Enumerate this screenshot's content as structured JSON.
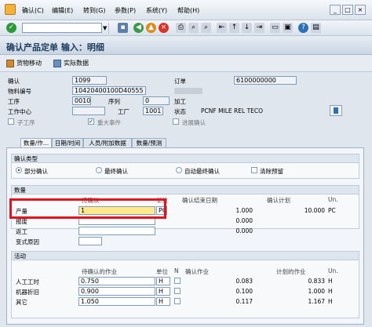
{
  "menu": {
    "items": [
      "确认(C)",
      "编辑(E)",
      "转到(G)",
      "参数(P)",
      "系统(Y)",
      "帮助(H)"
    ]
  },
  "window": {
    "title": "确认产品定单 输入：明细"
  },
  "app_toolbar": {
    "goods_movement": "货物移动",
    "actual_data": "实际数据"
  },
  "header": {
    "confirm_label": "确认",
    "confirm_value": "1099",
    "order_label": "订单",
    "order_value": "6100000000",
    "material_label": "物料编号",
    "material_value": "10420400100D40555",
    "op_label": "工序",
    "op_value": "0010",
    "seq_label": "序列",
    "seq_value": "0",
    "process_label": "加工",
    "wc_label": "工作中心",
    "plant_label": "工厂",
    "plant_value": "1001",
    "status_label": "状态",
    "status_value": "PCNF MILE REL  TECO",
    "sub_op_label": "子工序",
    "milestone_label": "重大事件",
    "timeline_label": "进展确认"
  },
  "tabs": [
    "数量/作...",
    "日期/时间",
    "人员/附加数据",
    "数量/预测"
  ],
  "confirm_type": {
    "title": "确认类型",
    "partial": "部分确认",
    "final": "最终确认",
    "auto_final": "自动最终确认",
    "clear_reserve": "清除预留"
  },
  "quantity": {
    "title": "数量",
    "col_to_confirm": "待确认",
    "col_unit": "单位",
    "col_confirm_end_date": "确认结束日期",
    "col_confirm_plan": "确认计划",
    "col_un": "Un.",
    "rows": [
      {
        "label": "产量",
        "value": "1",
        "unit": "PC",
        "confirmed": "1.000",
        "plan": "10.000",
        "un": "PC"
      },
      {
        "label": "报废",
        "value": "",
        "unit": "",
        "confirmed": "0.000",
        "plan": "",
        "un": ""
      },
      {
        "label": "返工",
        "value": "",
        "unit": "",
        "confirmed": "0.000",
        "plan": "",
        "un": ""
      },
      {
        "label": "变式原因",
        "value": "",
        "unit": "",
        "confirmed": "",
        "plan": "",
        "un": ""
      }
    ]
  },
  "activities": {
    "title": "活动",
    "col_to_confirm": "待确认的作业",
    "col_unit": "单位",
    "col_n": "N",
    "col_confirmed": "确认作业",
    "col_plan": "计划的作业",
    "col_un": "Un.",
    "rows": [
      {
        "label": "人工工时",
        "value": "0.750",
        "unit": "H",
        "confirmed": "0.083",
        "plan": "0.833",
        "un": "H"
      },
      {
        "label": "机器折旧",
        "value": "0.900",
        "unit": "H",
        "confirmed": "0.100",
        "plan": "1.000",
        "un": "H"
      },
      {
        "label": "其它",
        "value": "1.050",
        "unit": "H",
        "confirmed": "0.117",
        "plan": "1.167",
        "un": "H"
      }
    ]
  },
  "colors": {
    "highlight": "#e0141e",
    "active_field": "#ffe98a"
  }
}
